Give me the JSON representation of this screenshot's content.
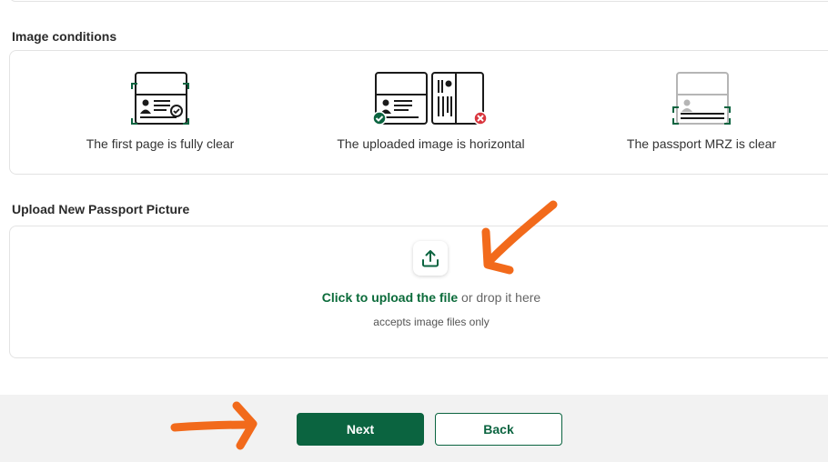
{
  "sections": {
    "image_conditions_title": "Image conditions",
    "upload_title": "Upload New Passport Picture"
  },
  "conditions": [
    {
      "caption": "The first page is fully clear",
      "icon": "passport-first-page-icon"
    },
    {
      "caption": "The uploaded image is horizontal",
      "icon": "passport-orientation-icon"
    },
    {
      "caption": "The passport MRZ is clear",
      "icon": "passport-mrz-icon"
    }
  ],
  "upload": {
    "link_text": "Click to upload the file",
    "rest_text": " or drop it here",
    "hint": "accepts image files only",
    "icon": "upload-icon"
  },
  "buttons": {
    "next": "Next",
    "back": "Back"
  },
  "colors": {
    "brand_green": "#0b6440",
    "link_green": "#0b6b3a",
    "error_red": "#d9363e",
    "annotation_orange": "#f26a1b"
  }
}
